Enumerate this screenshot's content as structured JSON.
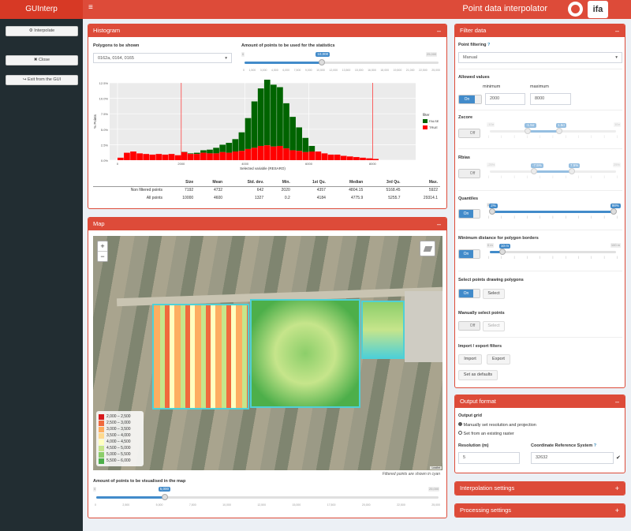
{
  "header": {
    "logo": "GUInterp",
    "title": "Point data interpolator",
    "menu_icon": "≡",
    "logo2": "ifa"
  },
  "sidebar": {
    "buttons": [
      {
        "icon": "⚙",
        "label": "Interpolate"
      },
      {
        "icon": "✖",
        "label": "Close"
      },
      {
        "icon": "↪",
        "label": "Exit from the GUI"
      }
    ]
  },
  "histogram": {
    "title": "Histogram",
    "toggle": "–",
    "polygons_label": "Polygons to be shown",
    "polygons_value": "0162a, 0164, 0165",
    "points_label": "Amount of points to be used for the statistics",
    "points_slider": {
      "min": "0",
      "max": "25,000",
      "value": "10,000",
      "fraction": 0.4,
      "ticks": [
        "0",
        "1,500",
        "3,000",
        "4,500",
        "6,000",
        "7,500",
        "9,000",
        "10,500",
        "12,000",
        "13,500",
        "15,000",
        "16,500",
        "18,000",
        "19,500",
        "21,000",
        "22,500",
        "25,000"
      ]
    },
    "chart": {
      "y_ticks": [
        "12.5%",
        "10.0%",
        "7.5%",
        "5.0%",
        "2.5%",
        "0.0%"
      ],
      "x_ticks": [
        "0",
        "2000",
        "4000",
        "6000",
        "8000"
      ],
      "xlabel": "Selected variable (RESARO)",
      "ylabel": "% Points",
      "legend_title": "filter",
      "legend": [
        {
          "name": "FALSE",
          "color": "#006400"
        },
        {
          "name": "TRUE",
          "color": "#ff0000"
        }
      ]
    },
    "stats": {
      "columns": [
        "",
        "Size",
        "Mean",
        "Std. dev.",
        "Min.",
        "1st Qu.",
        "Median",
        "3rd Qu.",
        "Max."
      ],
      "rows": [
        [
          "Non filtered points",
          "7192",
          "4732",
          "642",
          "2020",
          "4357",
          "4804.15",
          "5168.45",
          "5922"
        ],
        [
          "All points",
          "10000",
          "4600",
          "1327",
          "0.2",
          "4184",
          "4775.9",
          "5255.7",
          "29314.1"
        ]
      ]
    }
  },
  "chart_data": {
    "type": "bar",
    "title": "",
    "xlabel": "Selected variable (RESARO)",
    "ylabel": "% Points",
    "ylim": [
      0,
      12.5
    ],
    "x": [
      0,
      200,
      400,
      600,
      800,
      1000,
      1200,
      1400,
      1600,
      1800,
      2000,
      2200,
      2400,
      2600,
      2800,
      3000,
      3200,
      3400,
      3600,
      3800,
      4000,
      4200,
      4400,
      4600,
      4800,
      5000,
      5200,
      5400,
      5600,
      5800,
      6000,
      6200,
      6400,
      6600,
      6800,
      7000,
      7200,
      7400,
      7600,
      7800,
      8000
    ],
    "series": [
      {
        "name": "FALSE",
        "values": [
          0,
          0,
          0,
          0,
          0,
          0,
          0,
          0,
          0,
          0,
          0.05,
          0.1,
          0.2,
          0.4,
          0.6,
          0.9,
          1.2,
          1.6,
          2.0,
          3.0,
          5.0,
          7.5,
          9.3,
          11.3,
          10.0,
          9.5,
          7.3,
          5.4,
          3.8,
          2.3,
          0.9,
          0,
          0,
          0,
          0,
          0,
          0,
          0,
          0,
          0,
          0
        ]
      },
      {
        "name": "TRUE",
        "values": [
          0.4,
          1.2,
          1.4,
          1.1,
          1.0,
          0.9,
          1.0,
          0.9,
          1.0,
          0.8,
          1.3,
          1.0,
          1.0,
          1.2,
          1.1,
          1.1,
          1.3,
          1.2,
          1.4,
          1.5,
          1.8,
          2.0,
          2.3,
          2.4,
          2.2,
          2.3,
          1.9,
          1.6,
          1.5,
          1.3,
          1.4,
          1.4,
          1.1,
          0.9,
          0.9,
          0.7,
          0.6,
          0.5,
          0.4,
          0.3,
          0.2
        ]
      }
    ]
  },
  "map": {
    "title": "Map",
    "toggle": "–",
    "zoom_in": "+",
    "zoom_out": "−",
    "note": "Filtered points are shown in cyan",
    "attribution": "Leaflet",
    "legend": [
      {
        "label": "2,000 – 2,500",
        "color": "#d7191c"
      },
      {
        "label": "2,500 – 3,000",
        "color": "#f06a3d"
      },
      {
        "label": "3,000 – 3,500",
        "color": "#fdae61"
      },
      {
        "label": "3,500 – 4,000",
        "color": "#fed98e"
      },
      {
        "label": "4,000 – 4,500",
        "color": "#ffffbf"
      },
      {
        "label": "4,500 – 5,000",
        "color": "#c6e58b"
      },
      {
        "label": "5,000 – 5,500",
        "color": "#8cce6a"
      },
      {
        "label": "5,500 – 6,000",
        "color": "#4daf4a"
      }
    ],
    "points_label": "Amount of points to be visualised in the map",
    "points_slider": {
      "min": "0",
      "max": "25,000",
      "value": "5,000",
      "fraction": 0.2,
      "ticks": [
        "0",
        "2,500",
        "5,000",
        "7,500",
        "10,000",
        "12,500",
        "15,000",
        "17,500",
        "20,000",
        "22,500",
        "25,000"
      ]
    }
  },
  "filter": {
    "title": "Filter data",
    "toggle": "–",
    "point_filtering_label": "Point filtering",
    "point_filtering_value": "Manual",
    "allowed_label": "Allowed values",
    "min_label": "minimum",
    "max_label": "maximum",
    "min_value": "2000",
    "max_value": "8000",
    "allowed_switch": "On",
    "zscore_label": "Zscore",
    "zscore_switch": "Off",
    "zscore_slider": {
      "min": "-10σ",
      "max": "10σ",
      "lo": "-1.5σ",
      "hi": "1.5σ",
      "lo_frac": 0.3,
      "hi_frac": 0.55
    },
    "rbias_label": "Rbias",
    "rbias_switch": "Off",
    "rbias_slider": {
      "min": "-25%",
      "max": "25%",
      "lo": "-7.5%",
      "hi": "7.5%",
      "lo_frac": 0.35,
      "hi_frac": 0.65
    },
    "quantiles_label": "Quantiles",
    "quantiles_switch": "On",
    "quantiles_slider": {
      "min": "0%",
      "max": "100%",
      "lo": "2%",
      "hi": "98%",
      "lo_frac": 0.02,
      "hi_frac": 0.98
    },
    "distance_label": "Minimum distance for polygon borders",
    "distance_switch": "On",
    "distance_slider": {
      "min": "0 m",
      "max": "100 m",
      "value": "10 m",
      "fraction": 0.1
    },
    "draw_label": "Select points drawing polygons",
    "draw_switch": "On",
    "draw_select": "Select",
    "manual_label": "Manually select points",
    "manual_switch": "Off",
    "manual_select": "Select",
    "import_label": "Import / export filters",
    "import_btn": "Import",
    "export_btn": "Export",
    "default_btn": "Set as defaults"
  },
  "output": {
    "title": "Output format",
    "toggle": "–",
    "grid_label": "Output grid",
    "opt1": "Manually set resolution and projection",
    "opt2": "Set from an existing raster",
    "res_label": "Resolution (m)",
    "res_value": "5",
    "crs_label": "Coordinate Reference System",
    "crs_value": "32632"
  },
  "interp": {
    "title": "Interpolation settings",
    "toggle": "+"
  },
  "proc": {
    "title": "Processing settings",
    "toggle": "+"
  }
}
